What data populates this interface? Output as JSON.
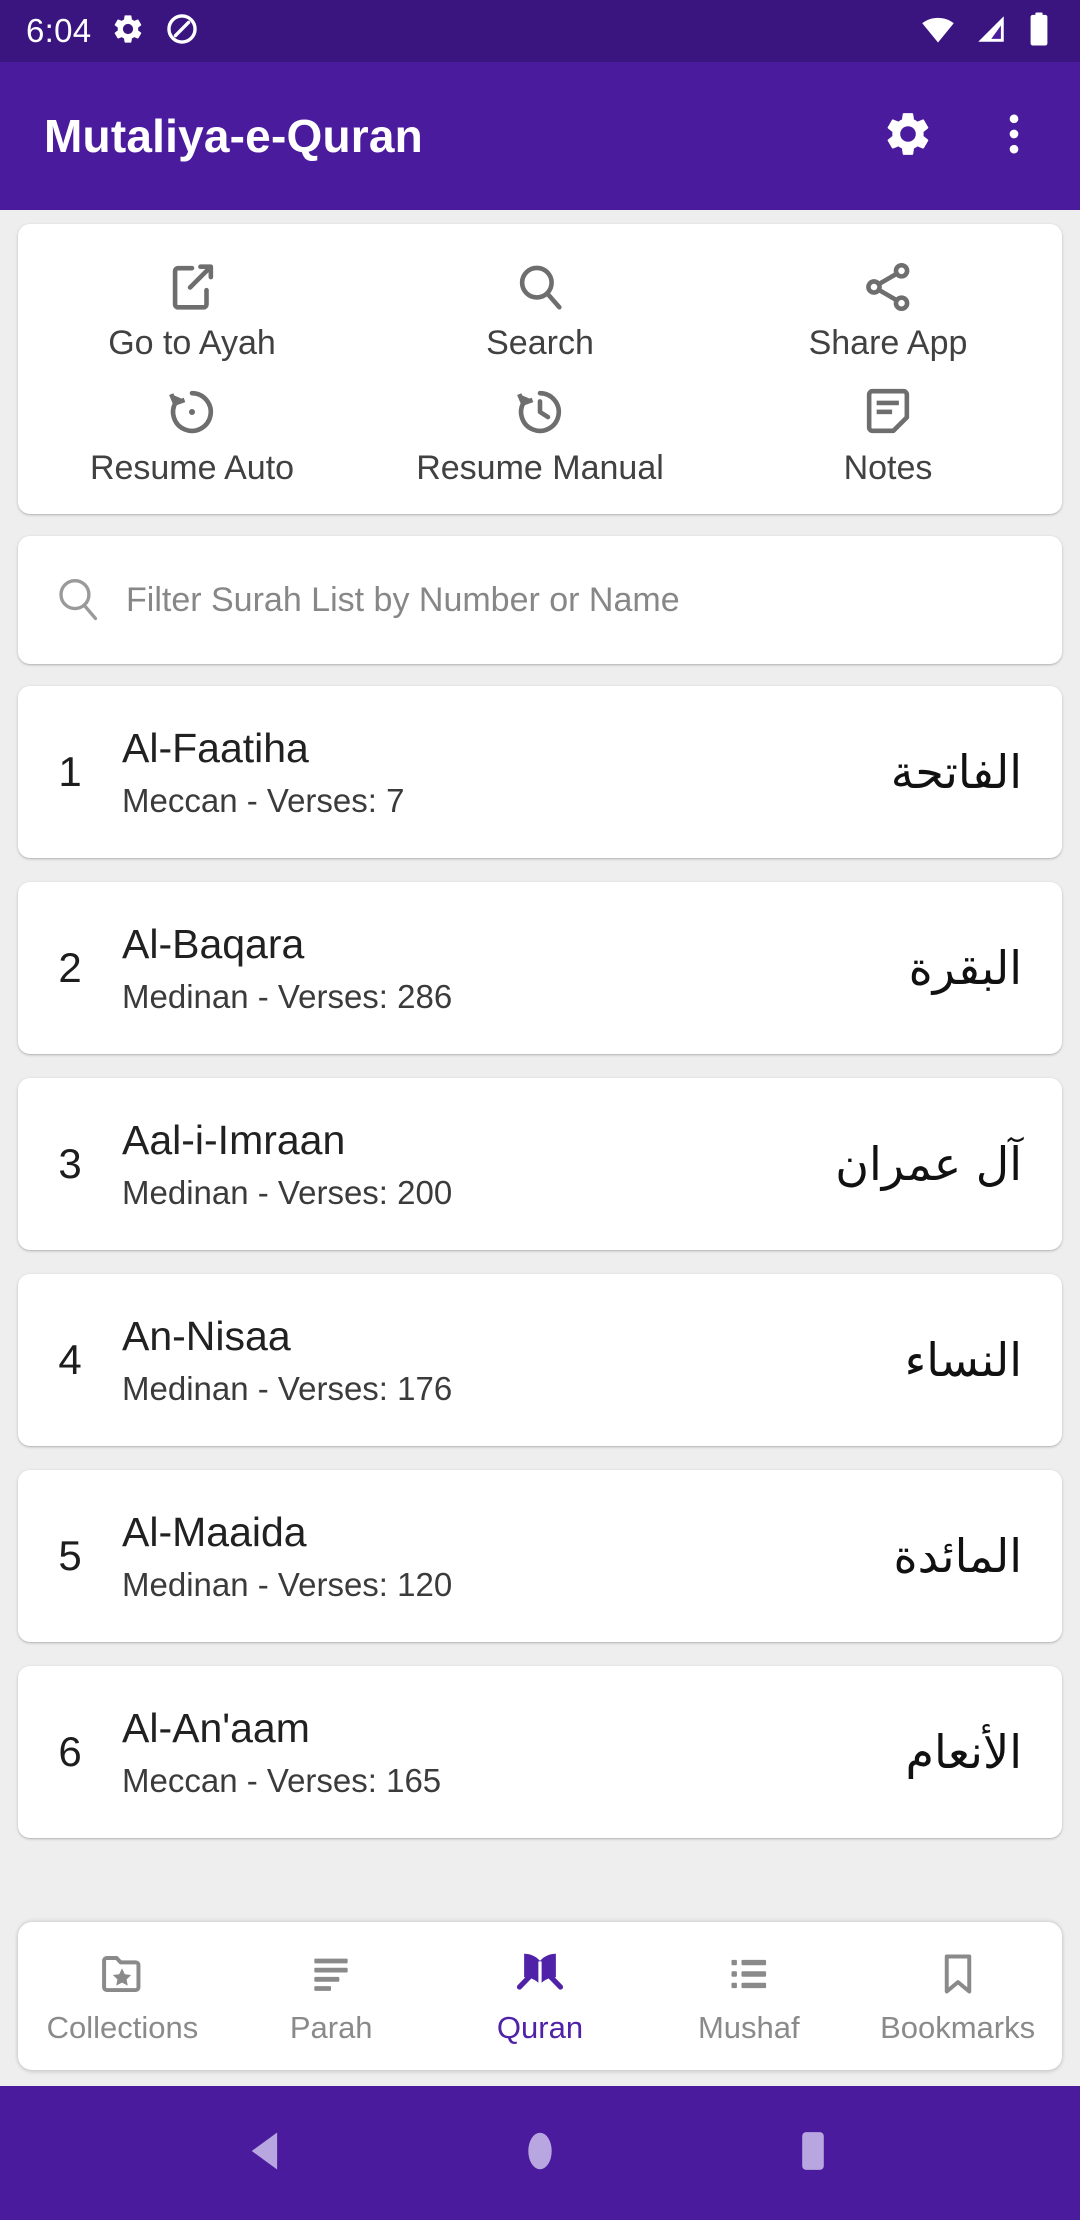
{
  "status_bar": {
    "time": "6:04",
    "icons_left": [
      "gear-icon",
      "do-not-disturb-icon"
    ],
    "icons_right": [
      "wifi-icon",
      "cellular-signal-icon",
      "battery-icon"
    ],
    "background_color": "#3a1580"
  },
  "app_bar": {
    "title": "Mutaliya-e-Quran",
    "settings_icon": "gear-icon",
    "overflow_icon": "more-vertical-icon",
    "background_color": "#4a1b9d"
  },
  "quick_actions": [
    {
      "label": "Go to Ayah",
      "icon": "open-in-new-icon"
    },
    {
      "label": "Search",
      "icon": "search-icon"
    },
    {
      "label": "Share App",
      "icon": "share-icon"
    },
    {
      "label": "Resume Auto",
      "icon": "restore-icon"
    },
    {
      "label": "Resume Manual",
      "icon": "history-icon"
    },
    {
      "label": "Notes",
      "icon": "note-icon"
    }
  ],
  "filter": {
    "placeholder": "Filter Surah List by Number or Name",
    "value": "",
    "icon": "search-icon"
  },
  "surahs": [
    {
      "number": "1",
      "name": "Al-Faatiha",
      "meta": "Meccan - Verses: 7",
      "arabic": "الفاتحة"
    },
    {
      "number": "2",
      "name": "Al-Baqara",
      "meta": "Medinan - Verses: 286",
      "arabic": "البقرة"
    },
    {
      "number": "3",
      "name": "Aal-i-Imraan",
      "meta": "Medinan - Verses: 200",
      "arabic": "آل عمران"
    },
    {
      "number": "4",
      "name": "An-Nisaa",
      "meta": "Medinan - Verses: 176",
      "arabic": "النساء"
    },
    {
      "number": "5",
      "name": "Al-Maaida",
      "meta": "Medinan - Verses: 120",
      "arabic": "المائدة"
    },
    {
      "number": "6",
      "name": "Al-An'aam",
      "meta": "Meccan - Verses: 165",
      "arabic": "الأنعام"
    }
  ],
  "bottom_nav": {
    "active": "Quran",
    "active_color": "#4f22a8",
    "inactive_color": "#8a8a8a",
    "items": [
      {
        "label": "Collections",
        "icon": "folder-star-icon"
      },
      {
        "label": "Parah",
        "icon": "short-text-lines-icon"
      },
      {
        "label": "Quran",
        "icon": "quran-book-icon"
      },
      {
        "label": "Mushaf",
        "icon": "list-icon"
      },
      {
        "label": "Bookmarks",
        "icon": "bookmark-icon"
      }
    ]
  },
  "android_nav": {
    "background_color": "#4a1b9d",
    "buttons": [
      {
        "name": "back-button",
        "icon": "back-triangle-icon"
      },
      {
        "name": "home-button",
        "icon": "home-circle-icon"
      },
      {
        "name": "recents-button",
        "icon": "recents-square-icon"
      }
    ]
  }
}
